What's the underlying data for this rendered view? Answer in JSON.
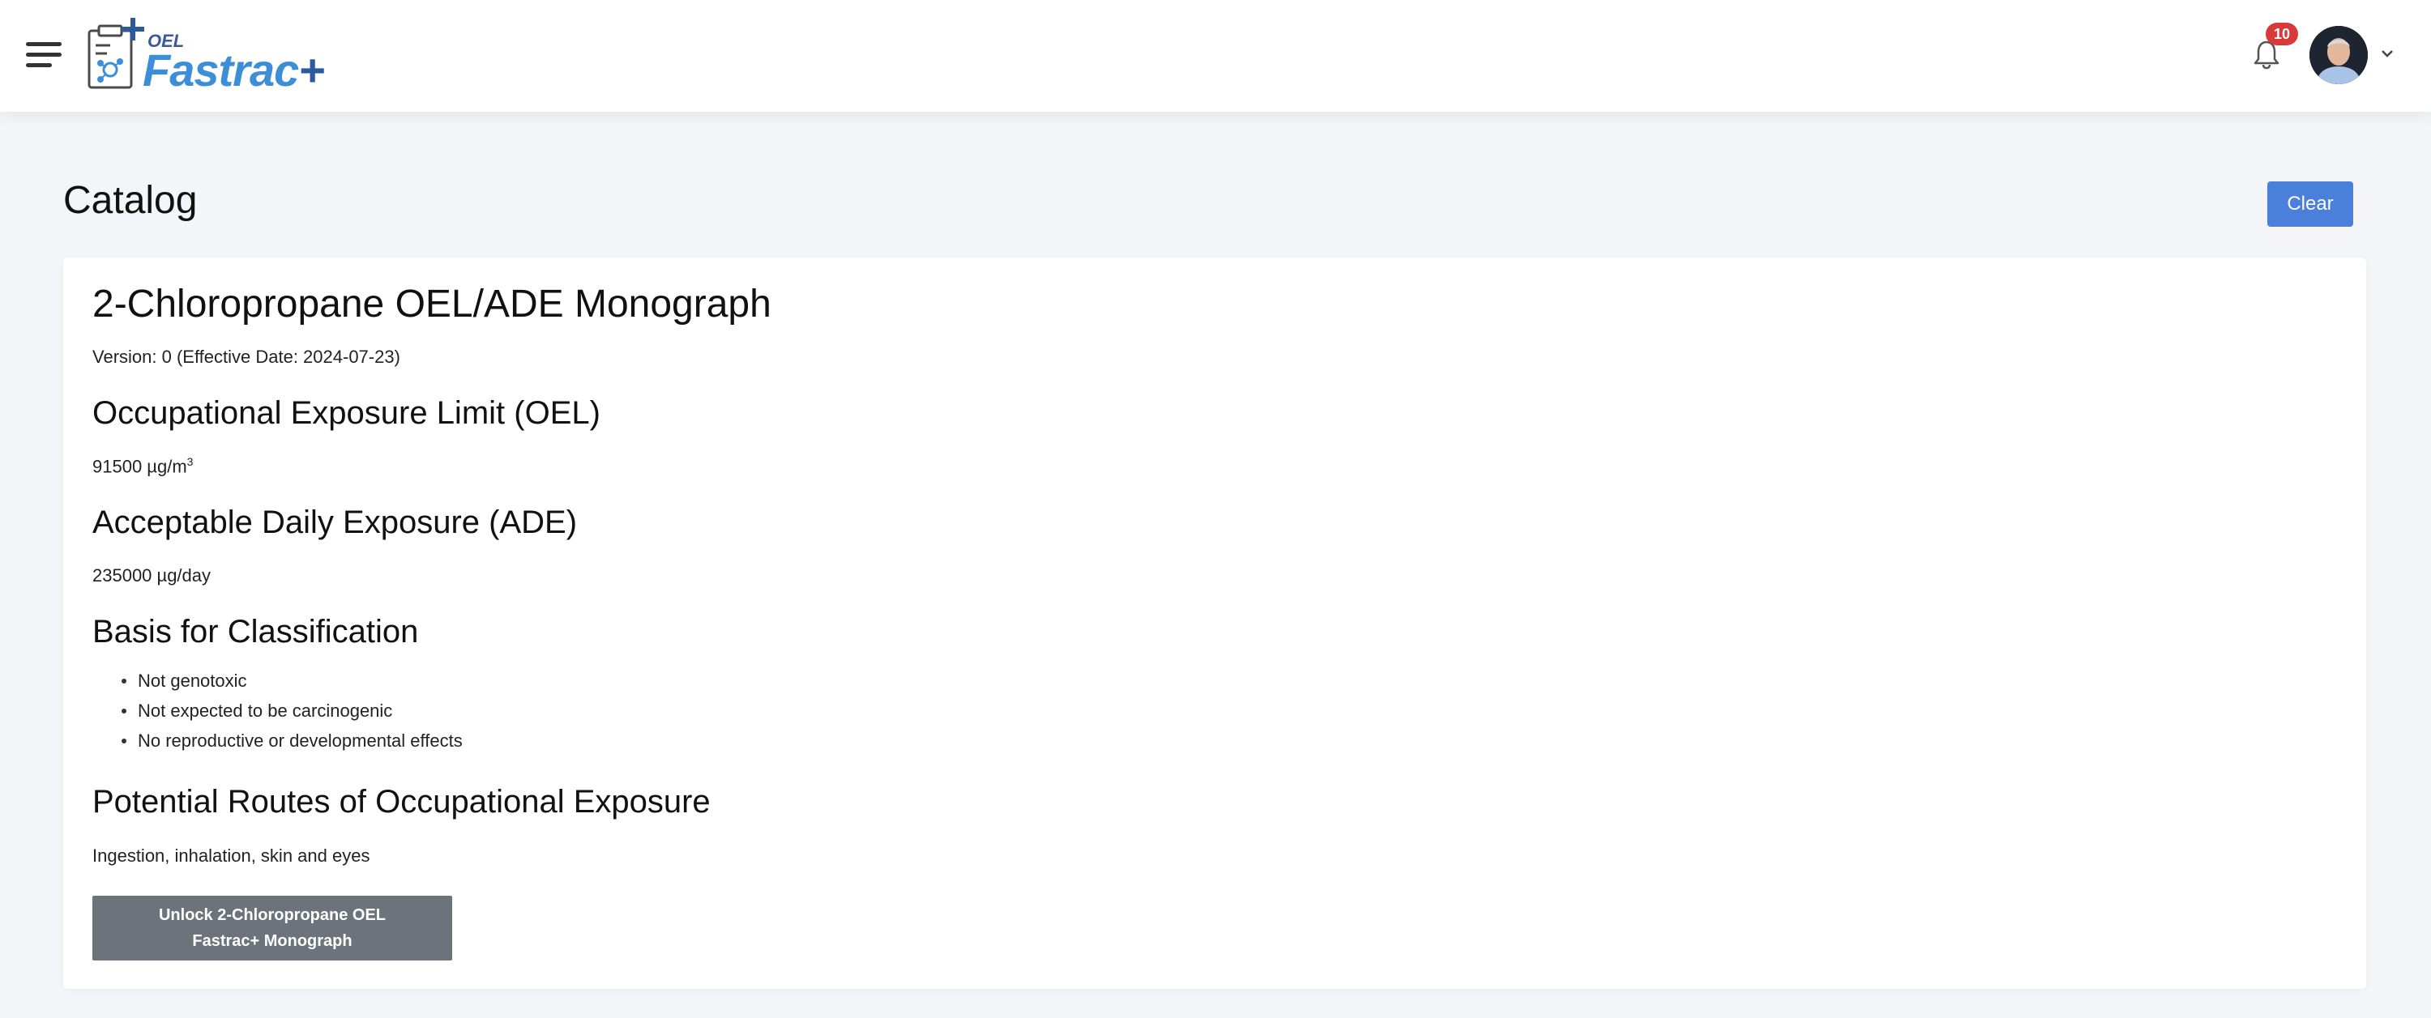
{
  "header": {
    "logo": {
      "small": "OEL",
      "name": "Fastrac",
      "plus": "+"
    },
    "notifications": {
      "count": "10",
      "icon": "bell-icon"
    },
    "user": {
      "icon": "avatar"
    }
  },
  "page": {
    "title": "Catalog",
    "clear_label": "Clear"
  },
  "monograph": {
    "title": "2-Chloropropane OEL/ADE Monograph",
    "version": "Version: 0 (Effective Date: 2024-07-23)",
    "oel_heading": "Occupational Exposure Limit (OEL)",
    "oel_value": "91500 µg/m",
    "oel_unit_sup": "3",
    "ade_heading": "Acceptable Daily Exposure (ADE)",
    "ade_value": "235000 µg/day",
    "basis_heading": "Basis for Classification",
    "basis_items": [
      "Not genotoxic",
      "Not expected to be carcinogenic",
      "No reproductive or developmental effects"
    ],
    "routes_heading": "Potential Routes of Occupational Exposure",
    "routes_value": "Ingestion, inhalation, skin and eyes",
    "unlock_label": "Unlock 2-Chloropropane OEL Fastrac+ Monograph"
  },
  "colors": {
    "accent": "#4a7fdb",
    "badge": "#d83a3a",
    "unlock_button": "#6c737b",
    "logo_blue": "#3d8ed9"
  }
}
